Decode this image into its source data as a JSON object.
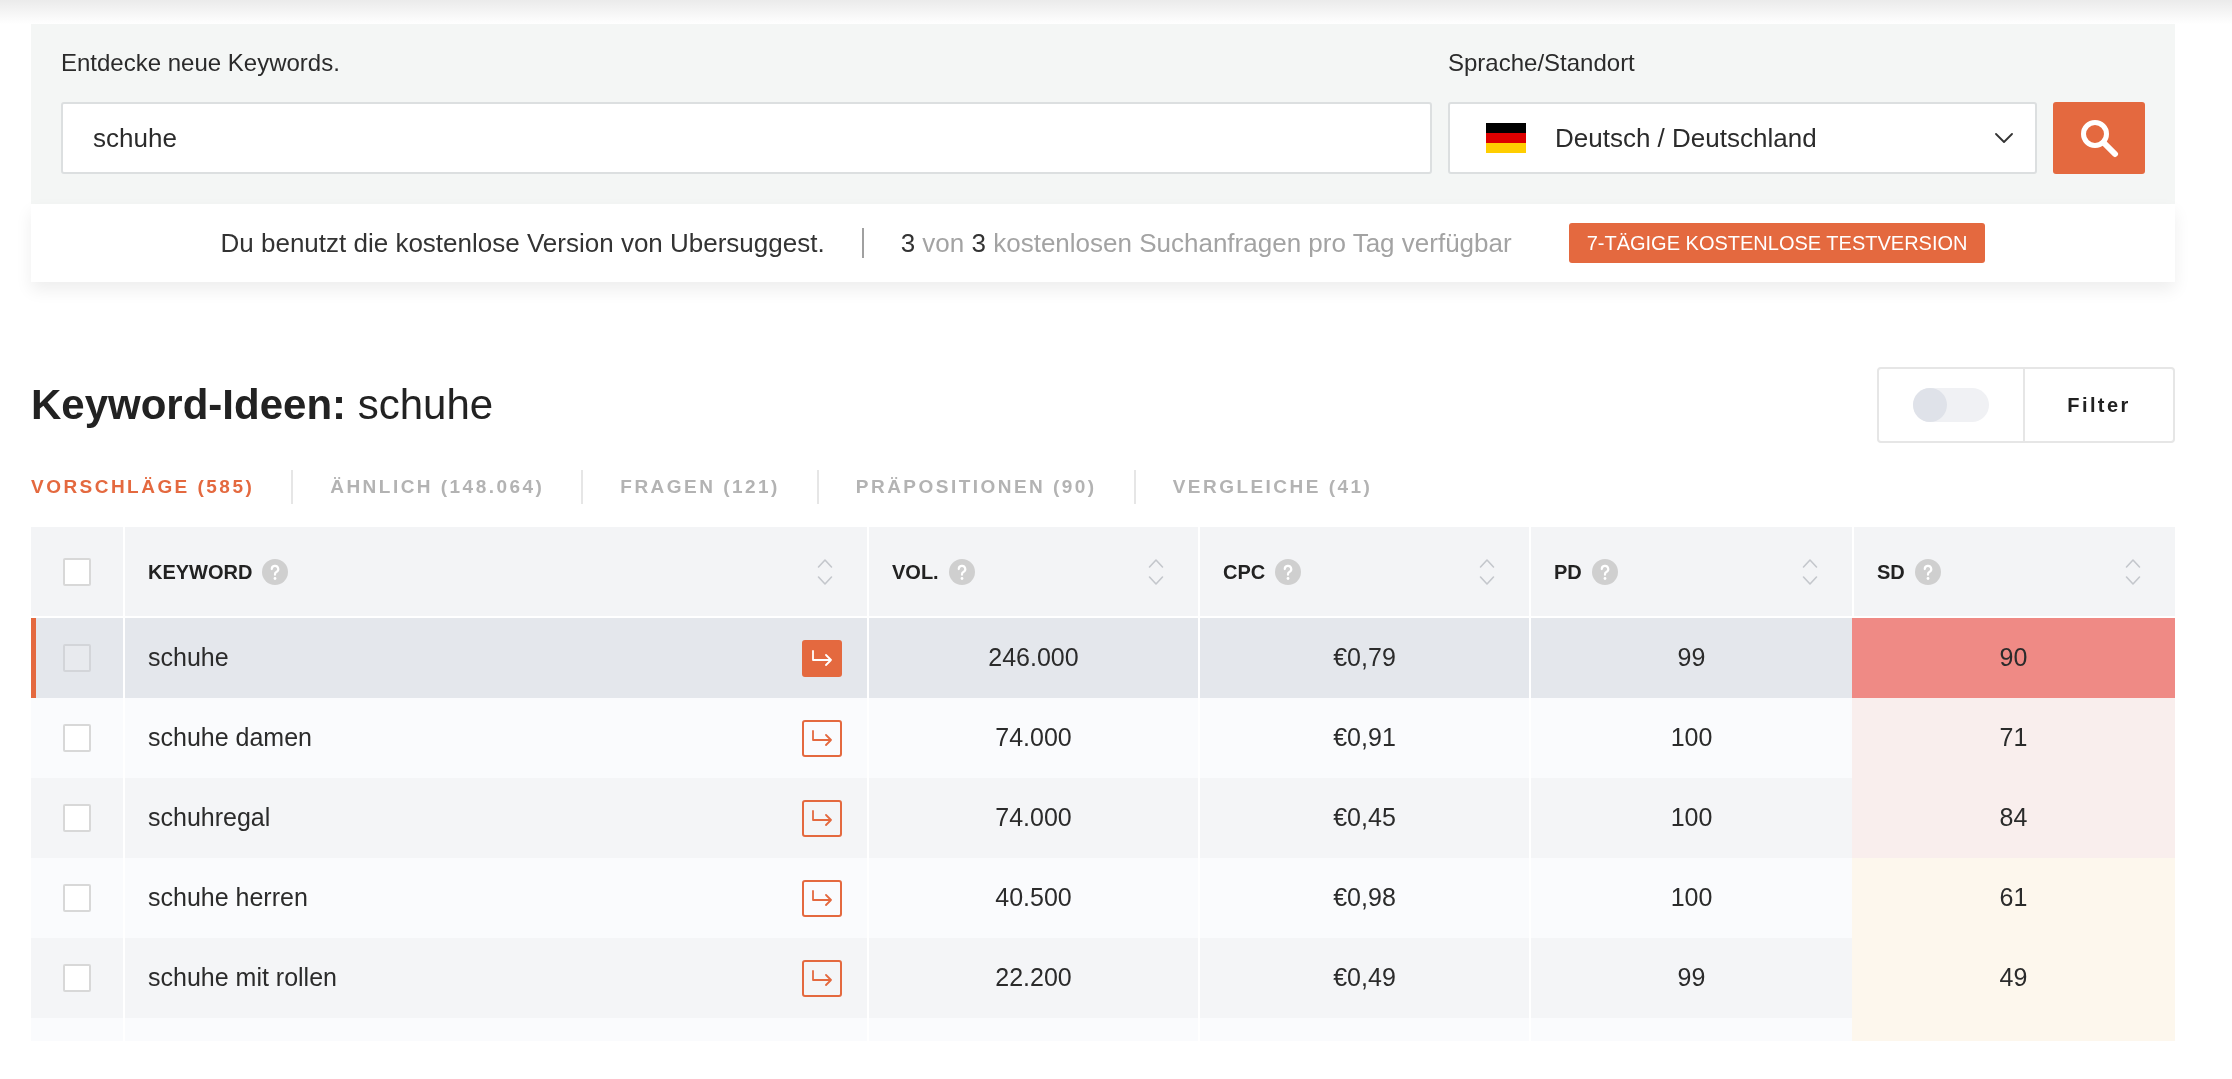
{
  "search": {
    "label": "Entdecke neue Keywords.",
    "value": "schuhe"
  },
  "location": {
    "label": "Sprache/Standort",
    "value": "Deutsch / Deutschland"
  },
  "notice": {
    "text": "Du benutzt die kostenlose Version von Ubersuggest.",
    "usage": "**3** von **3** kostenlosen Suchanfragen pro Tag verfügbar",
    "button": "7-TÄGIGE KOSTENLOSE TESTVERSION"
  },
  "heading": "**Keyword-Ideen:** schuhe",
  "filter": {
    "toggle": {
      "on": false
    },
    "label": "Filter"
  },
  "tabs": [
    {
      "label": "VORSCHLÄGE (585)",
      "selected": true
    },
    {
      "label": "ÄHNLICH (148.064)",
      "selected": false
    },
    {
      "label": "FRAGEN (121)",
      "selected": false
    },
    {
      "label": "PRÄPOSITIONEN (90)",
      "selected": false
    },
    {
      "label": "VERGLEICHE (41)",
      "selected": false
    }
  ],
  "table": {
    "select_all": {
      "checked": false
    },
    "columns": [
      "KEYWORD",
      "VOL.",
      "CPC",
      "PD",
      "SD"
    ],
    "rows": [
      {
        "checked": false,
        "selected": true,
        "keyword": "schuhe",
        "volume": "246.000",
        "cpc": "€0,79",
        "pd": "99",
        "sd": {
          "value": "90",
          "color": "#ef8a85"
        }
      },
      {
        "checked": false,
        "selected": false,
        "keyword": "schuhe damen",
        "volume": "74.000",
        "cpc": "€0,91",
        "pd": "100",
        "sd": {
          "value": "71",
          "color": "#f9eeed"
        }
      },
      {
        "checked": false,
        "selected": false,
        "keyword": "schuhregal",
        "volume": "74.000",
        "cpc": "€0,45",
        "pd": "100",
        "sd": {
          "value": "84",
          "color": "#f9eeed"
        }
      },
      {
        "checked": false,
        "selected": false,
        "keyword": "schuhe herren",
        "volume": "40.500",
        "cpc": "€0,98",
        "pd": "100",
        "sd": {
          "value": "61",
          "color": "#fdf7ed"
        }
      },
      {
        "checked": false,
        "selected": false,
        "keyword": "schuhe mit rollen",
        "volume": "22.200",
        "cpc": "€0,49",
        "pd": "99",
        "sd": {
          "value": "49",
          "color": "#fdf7ed"
        }
      }
    ]
  }
}
